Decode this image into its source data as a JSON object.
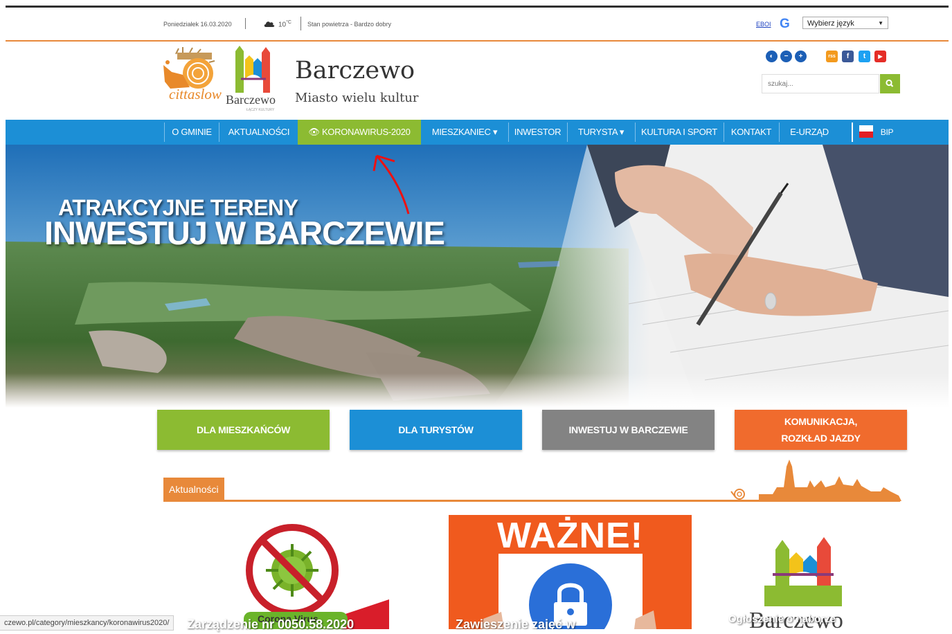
{
  "infobar": {
    "date": "Poniedziałek 16.03.2020",
    "temp_value": "10",
    "temp_unit": "°C",
    "air_quality": "Stan powietrza - Bardzo dobry",
    "eboi_link": "EBOI",
    "google_letter": "G",
    "language_select": "Wybierz język",
    "language_arrow": "▼"
  },
  "header": {
    "cittaslow": "cittaslow",
    "logo_name": "Barczewo",
    "logo_tagline": "ŁĄCZY KULTURY",
    "title": "Barczewo",
    "subtitle": "Miasto wielu kultur",
    "search_placeholder": "szukaj...",
    "tools": [
      "◐",
      "−",
      "+",
      "rss",
      "f",
      "t",
      "▶"
    ]
  },
  "nav": {
    "items": [
      "O GMINIE",
      "AKTUALNOŚCI",
      "👁 KORONAWIRUS-2020",
      "MIESZKANIEC ▾",
      "INWESTOR",
      "TURYSTA ▾",
      "KULTURA I SPORT",
      "KONTAKT",
      "E-URZĄD"
    ],
    "bip": "BIP",
    "active_index": 2
  },
  "hero": {
    "line1": "ATRAKCYJNE TERENY",
    "line2": "INWESTUJ W BARCZEWIE"
  },
  "tiles": [
    {
      "label": "DLA MIESZKAŃCÓW",
      "color": "#8cbb32"
    },
    {
      "label": "DLA TURYSTÓW",
      "color": "#1c8fd6"
    },
    {
      "label": "INWESTUJ W BARCZEWIE",
      "color": "#838383"
    },
    {
      "label": "KOMUNIKACJA,\nROZKŁAD JAZDY",
      "color": "#f06b2d"
    }
  ],
  "news": {
    "label": "Aktualności",
    "cards": [
      {
        "title": "Zarządzenie nr 0050.58.2020",
        "badge": "Corona Virus"
      },
      {
        "title": "Zawieszenie zajęć w",
        "banner": "WAŻNE!"
      },
      {
        "title": "Ogłoszenie o naborze",
        "logo": "Barczewo"
      }
    ]
  },
  "status_url": "czewo.pl/category/mieszkancy/koronawirus2020/",
  "colors": {
    "nav_blue": "#1c8fd6",
    "green": "#8cbb32",
    "orange": "#e8893a"
  }
}
